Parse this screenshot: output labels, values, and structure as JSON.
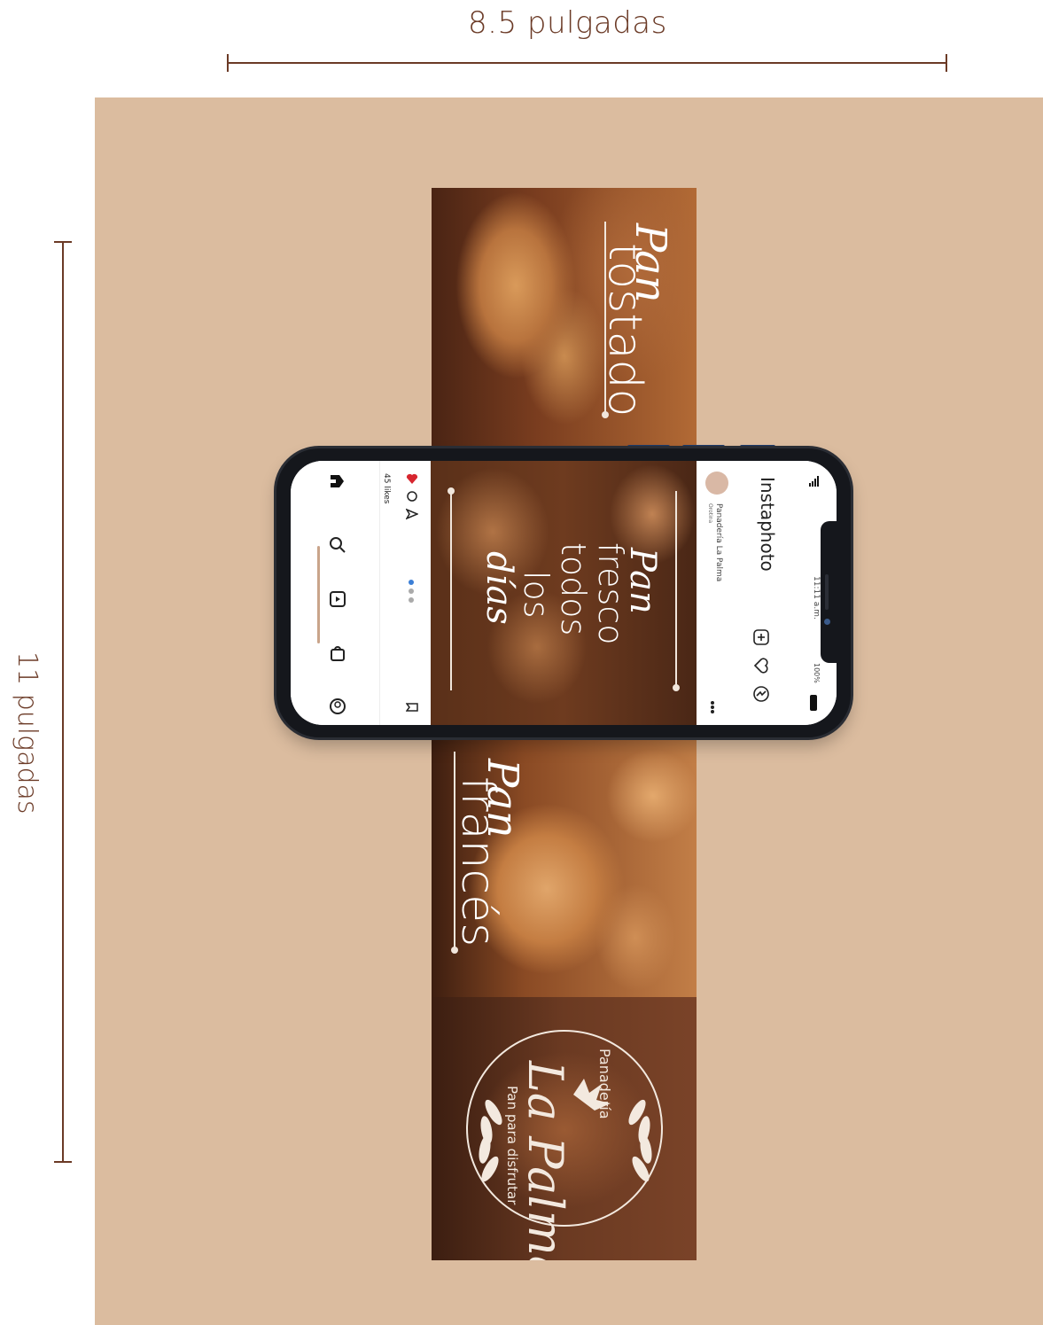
{
  "dimensions": {
    "width_label": "8.5 pulgadas",
    "height_label": "11 pulgadas",
    "line_color": "#6b3a26"
  },
  "background_color": "#dbbc9f",
  "panels": [
    {
      "script": "Pan",
      "word": "tostado"
    },
    {
      "script": "Pan",
      "word": "francés"
    }
  ],
  "phone": {
    "status": {
      "time": "11:11 a.m.",
      "battery": "100%"
    },
    "app_name": "Instaphoto",
    "account": "Panadería La Palma",
    "account_sub": "Orotina",
    "post": {
      "script": "Pan",
      "lines": [
        "fresco",
        "todos",
        "los"
      ],
      "script_last": "días"
    },
    "likes": "45 likes",
    "icons": [
      "signal-icon",
      "new-post-icon",
      "heart-icon",
      "messenger-icon",
      "more-icon",
      "like-icon",
      "comment-icon",
      "share-icon",
      "bookmark-icon",
      "home-icon",
      "search-icon",
      "reels-icon",
      "shop-icon",
      "profile-icon"
    ]
  },
  "logo": {
    "top": "Panadería",
    "name": "La Palma",
    "tagline": "Pan para disfrutar"
  }
}
